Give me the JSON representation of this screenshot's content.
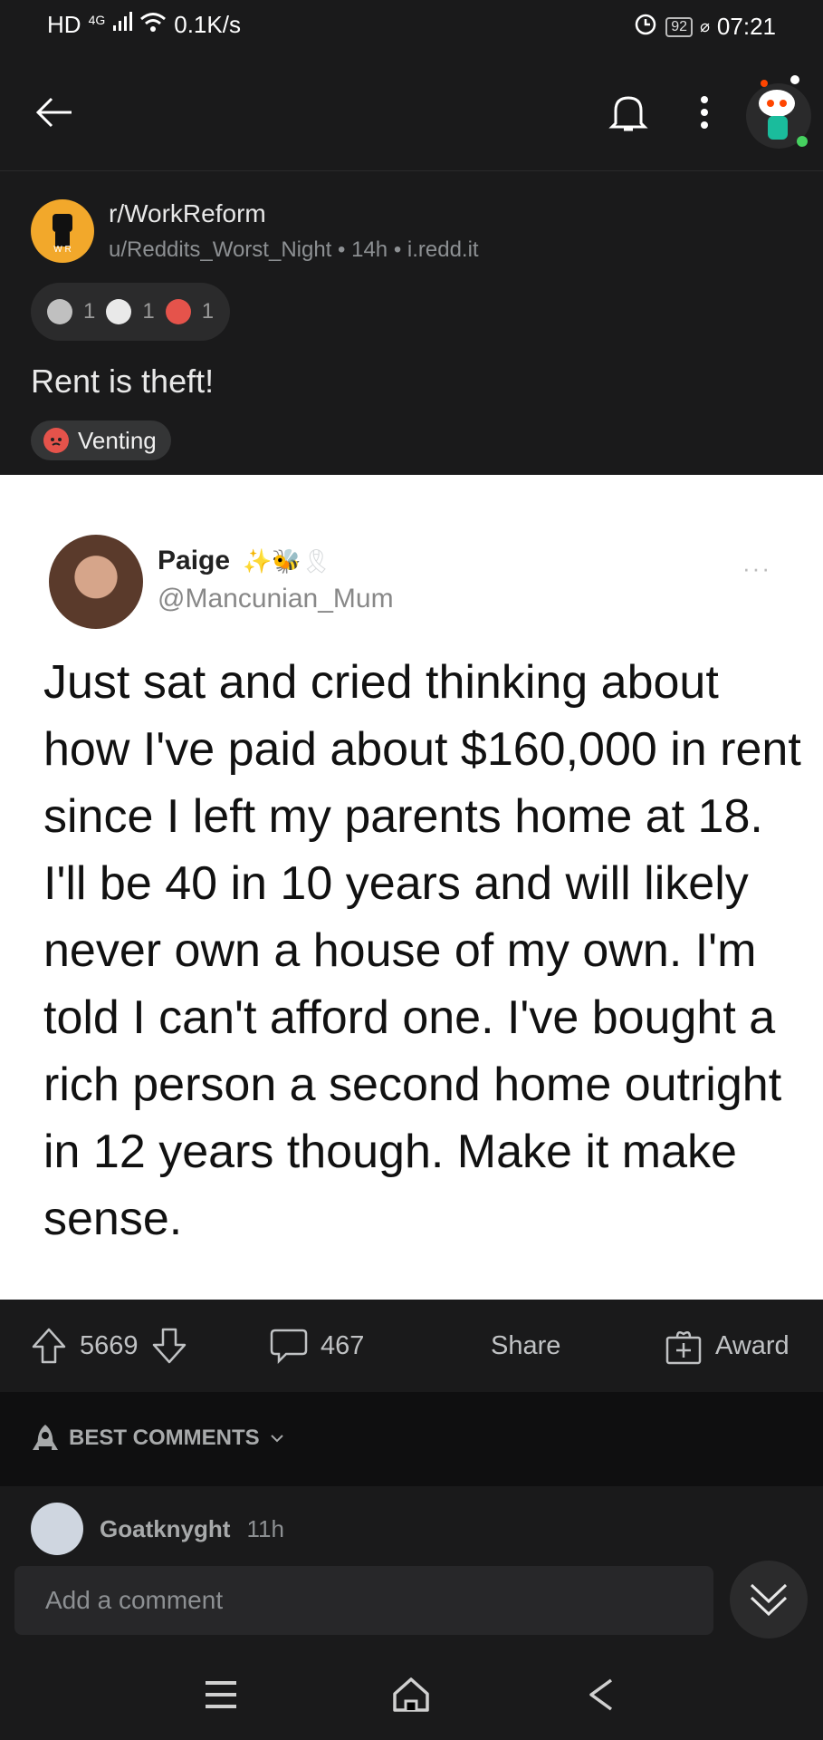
{
  "status_bar": {
    "network": "HD",
    "signal": "4G",
    "speed": "0.1K/s",
    "battery": "92",
    "time": "07:21"
  },
  "app_bar": {
    "back_icon": "arrow-left-icon",
    "bell_icon": "bell-icon",
    "more_icon": "vertical-dots-icon",
    "avatar_icon": "snoo-avatar"
  },
  "post": {
    "community": "r/WorkReform",
    "author": "u/Reddits_Worst_Night",
    "age": "14h",
    "domain": "i.redd.it",
    "awards": [
      {
        "icon": "silver-award-icon",
        "count": "1",
        "color": "#c0c0c0"
      },
      {
        "icon": "wholesome-award-icon",
        "count": "1",
        "color": "#e9e9e9"
      },
      {
        "icon": "twenty-award-icon",
        "count": "1",
        "color": "#e5534b"
      }
    ],
    "title": "Rent is theft!",
    "flair": "Venting"
  },
  "tweet": {
    "name": "Paige",
    "badges": "✨🐝🎗",
    "handle": "@Mancunian_Mum",
    "more": "···",
    "text": "Just sat and cried thinking about how I've paid about $160,000 in rent since I left my parents home at 18. I'll be 40 in 10 years and will likely never own a house of my own. I'm told I can't afford one. I've bought a rich person a second home outright in 12 years though. Make it make sense."
  },
  "actions": {
    "score": "5669",
    "comments": "467",
    "share": "Share",
    "award": "Award"
  },
  "comments": {
    "sort_label": "BEST COMMENTS",
    "first_user": "Goatknyght",
    "first_time": "11h",
    "add_placeholder": "Add a comment"
  },
  "colors": {
    "background": "#1a1a1b",
    "accent_award": "#f2a82b",
    "online_dot": "#46d160"
  }
}
